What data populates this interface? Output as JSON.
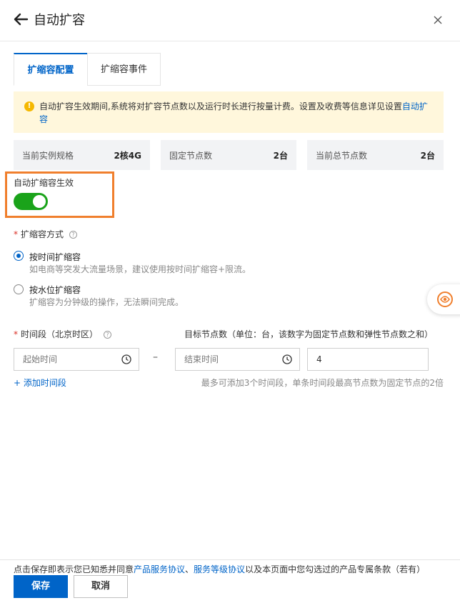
{
  "header": {
    "title": "自动扩容"
  },
  "tabs": [
    {
      "label": "扩缩容配置",
      "active": true
    },
    {
      "label": "扩缩容事件",
      "active": false
    }
  ],
  "notice": {
    "text": "自动扩容生效期间,系统将对扩容节点数以及运行时长进行按量计费。设置及收费等信息详见设置",
    "link": "自动扩容"
  },
  "stats": [
    {
      "label": "当前实例规格",
      "value": "2核4G"
    },
    {
      "label": "固定节点数",
      "value": "2台"
    },
    {
      "label": "当前总节点数",
      "value": "2台"
    }
  ],
  "autoscale": {
    "label": "自动扩缩容生效",
    "enabled": true
  },
  "mode": {
    "label": "扩缩容方式",
    "required_mark": "*",
    "options": [
      {
        "title": "按时间扩缩容",
        "desc": "如电商等突发大流量场景，建议使用按时间扩缩容+限流。",
        "checked": true
      },
      {
        "title": "按水位扩缩容",
        "desc": "扩缩容为分钟级的操作，无法瞬间完成。",
        "checked": false
      }
    ]
  },
  "schedule": {
    "time_label": "时间段（北京时区）",
    "target_label": "目标节点数（单位：台，该数字为固定节点数和弹性节点数之和）",
    "start_placeholder": "起始时间",
    "end_placeholder": "结束时间",
    "separator": "–",
    "target_value": "4",
    "add_label": "+ 添加时间段",
    "hint": "最多可添加3个时间段，单条时间段最高节点数为固定节点的2倍"
  },
  "footer": {
    "agreement_prefix": "点击保存即表示您已知悉并同意",
    "link1": "产品服务协议",
    "sep": "、",
    "link2": "服务等级协议",
    "agreement_suffix": "以及本页面中您勾选过的产品专属条款（若有）",
    "save_label": "保存",
    "cancel_label": "取消"
  },
  "colors": {
    "primary": "#0064c8",
    "toggle_on": "#1aa31a",
    "highlight": "#f07f2d",
    "notice_bg": "#fff7dc"
  }
}
